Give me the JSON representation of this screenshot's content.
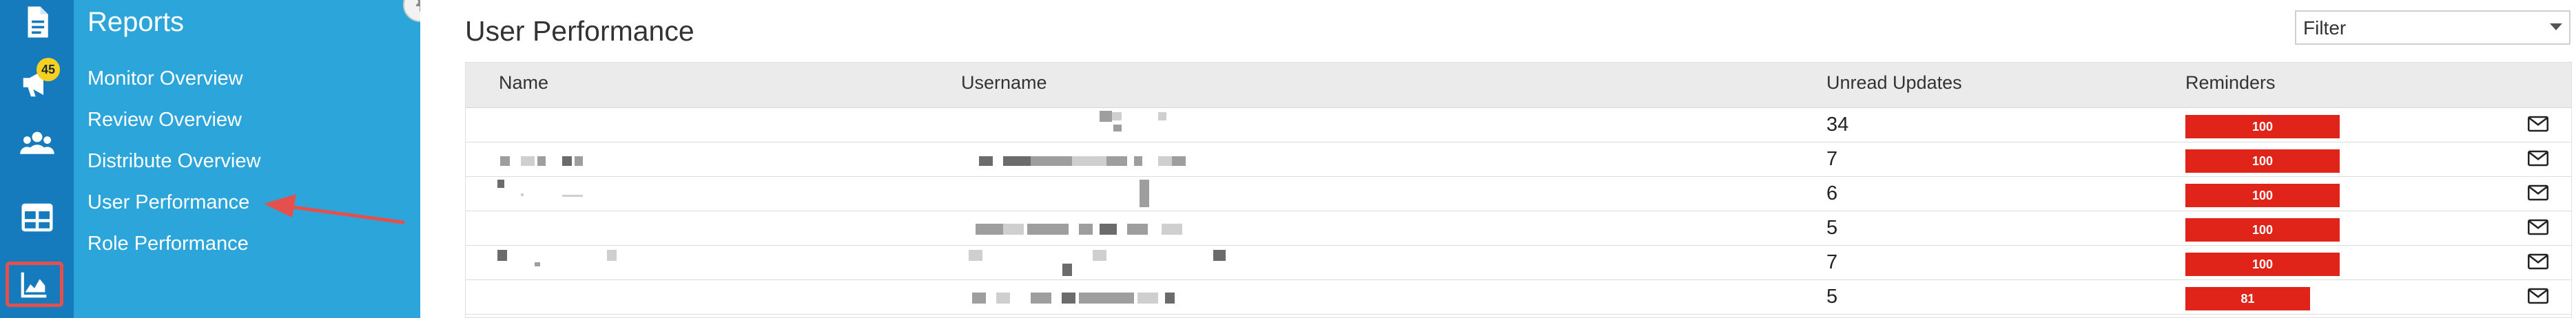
{
  "rail": {
    "items": [
      {
        "icon": "document-icon"
      },
      {
        "icon": "megaphone-icon",
        "badge": "45"
      },
      {
        "icon": "users-icon"
      },
      {
        "icon": "table-icon"
      },
      {
        "icon": "chart-area-icon",
        "active": true
      }
    ]
  },
  "panel": {
    "title": "Reports",
    "items": [
      {
        "label": "Monitor Overview"
      },
      {
        "label": "Review Overview"
      },
      {
        "label": "Distribute Overview"
      },
      {
        "label": "User Performance",
        "selected": true
      },
      {
        "label": "Role Performance"
      }
    ]
  },
  "main": {
    "title": "User Performance",
    "filter": {
      "label": "Filter"
    },
    "table": {
      "headers": {
        "name": "Name",
        "username": "Username",
        "unread": "Unread Updates",
        "reminders": "Reminders"
      },
      "rows": [
        {
          "unread": "34",
          "reminders": "100",
          "reminder_fraction": 1.0
        },
        {
          "unread": "7",
          "reminders": "100",
          "reminder_fraction": 1.0
        },
        {
          "unread": "6",
          "reminders": "100",
          "reminder_fraction": 1.0
        },
        {
          "unread": "5",
          "reminders": "100",
          "reminder_fraction": 1.0
        },
        {
          "unread": "7",
          "reminders": "100",
          "reminder_fraction": 1.0
        },
        {
          "unread": "5",
          "reminders": "81",
          "reminder_fraction": 0.81
        }
      ]
    }
  },
  "colors": {
    "rail": "#157bbd",
    "panel": "#2ba5da",
    "reminder": "#e1241a",
    "annotation": "#e5504d"
  }
}
